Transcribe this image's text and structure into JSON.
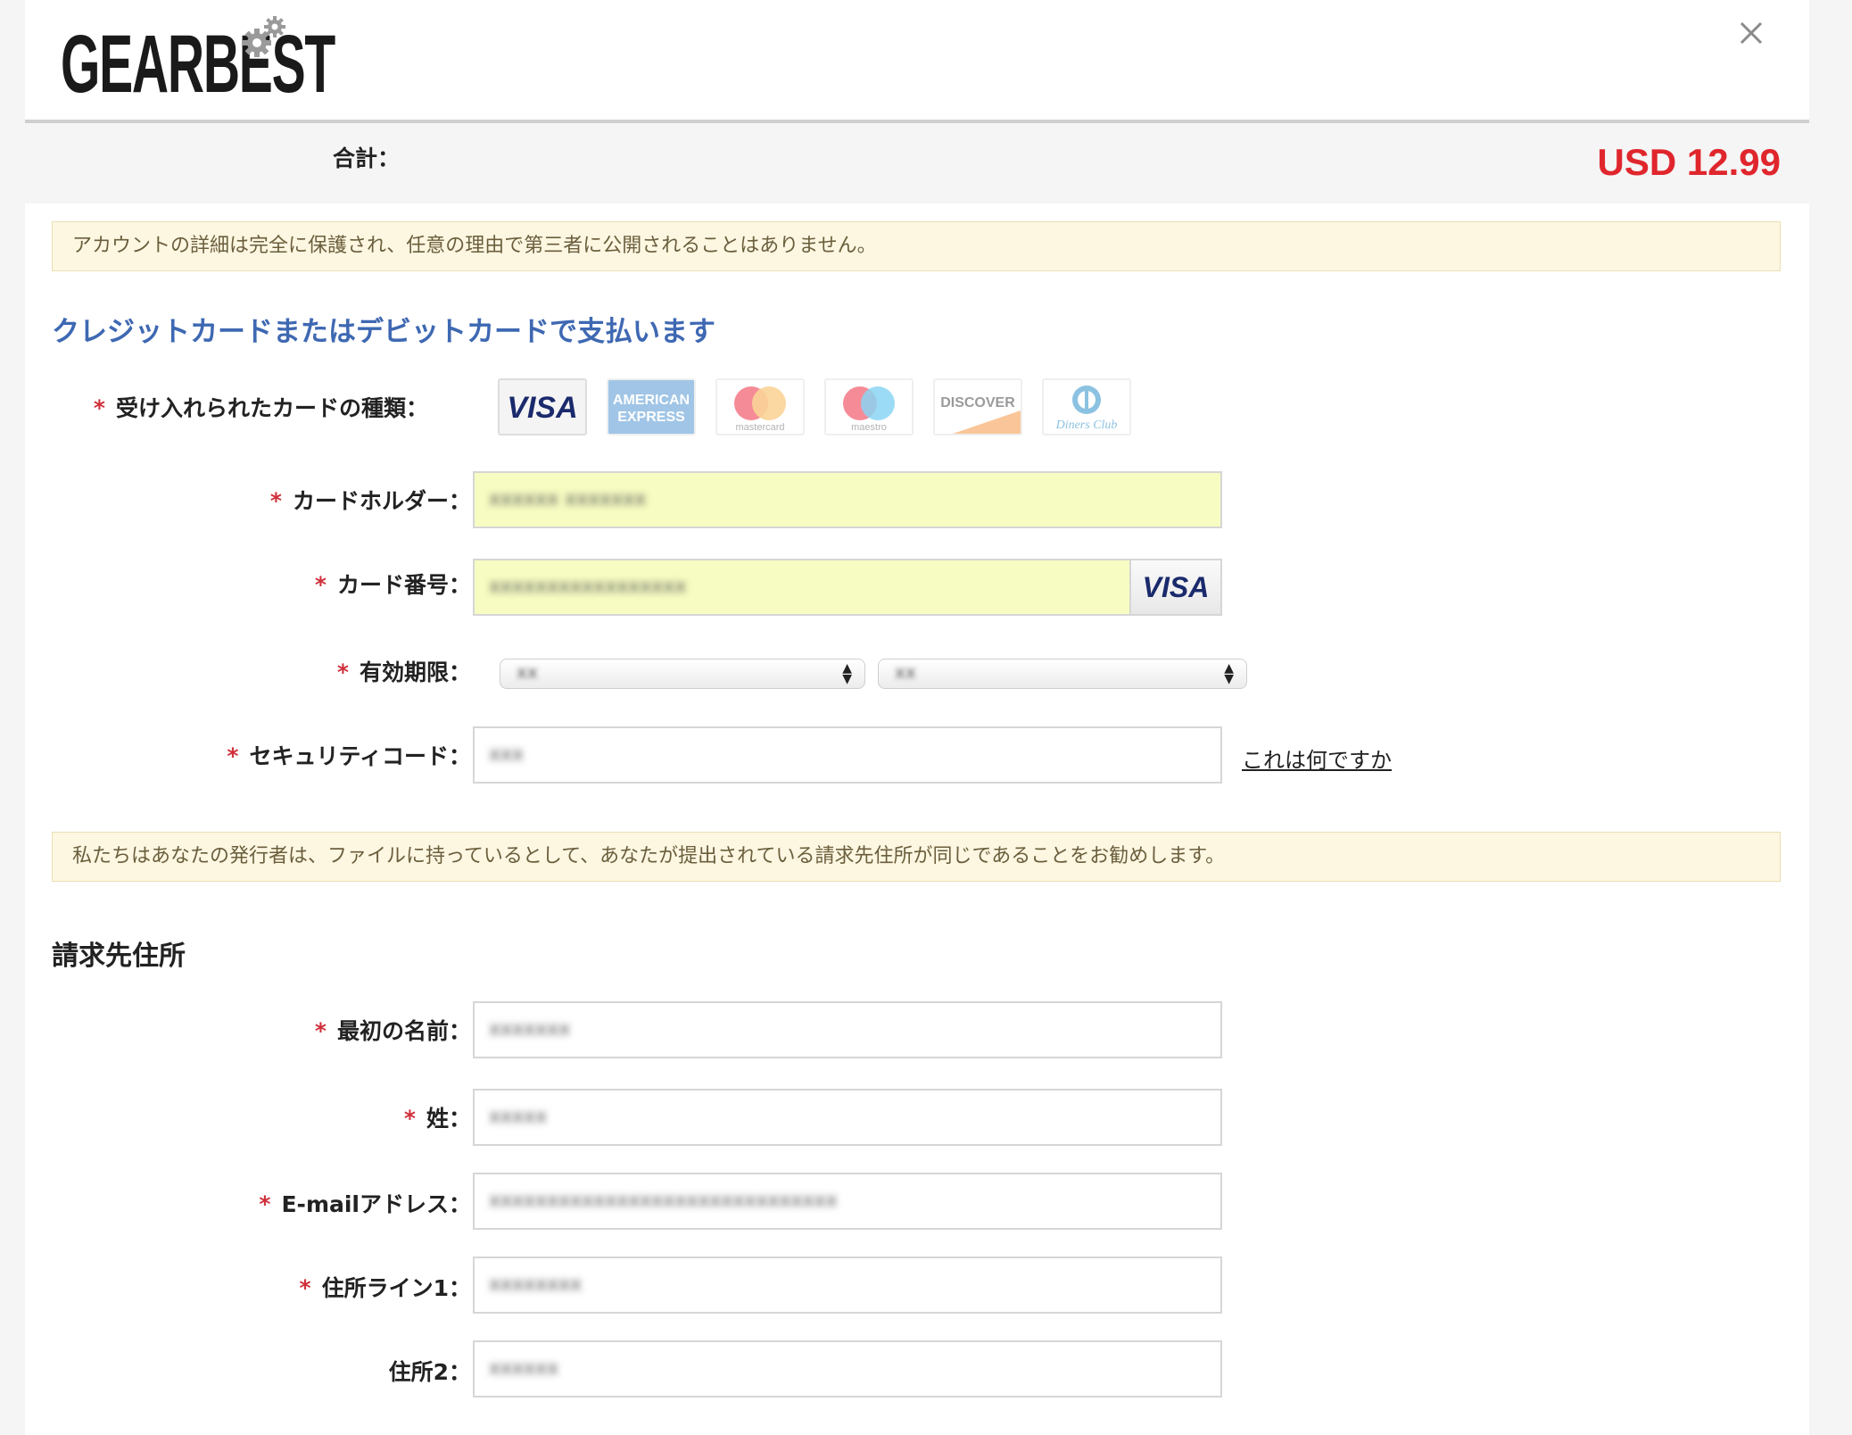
{
  "header": {
    "logo_text": "GEARBEST",
    "logo_icon": "gear-icon",
    "close_icon": "close-icon"
  },
  "total": {
    "label": "合計：",
    "amount": "USD 12.99",
    "amount_color": "#e0262d"
  },
  "notice_privacy": "アカウントの詳細は完全に保護され、任意の理由で第三者に公開されることはありません。",
  "payment": {
    "title": "クレジットカードまたはデビットカードで支払います",
    "title_color": "#3e68b2",
    "accepted_cards_label": "受け入れられたカードの種類：",
    "accepted_cards": [
      "VISA",
      "AMERICAN EXPRESS",
      "mastercard",
      "maestro",
      "DISCOVER",
      "Diners Club"
    ],
    "cardholder_label": "カードホルダー：",
    "cardholder_value": "xxxxxx xxxxxxx",
    "card_number_label": "カード番号：",
    "card_number_value": "xxxxxxxxxxxxxxxxx",
    "card_brand_badge": "VISA",
    "expiry_label": "有効期限：",
    "expiry_month_value": "xx",
    "expiry_year_value": "xx",
    "cvv_label": "セキュリティコード：",
    "cvv_value": "xxx",
    "cvv_help_link": "これは何ですか"
  },
  "notice_billing": "私たちはあなたの発行者は、ファイルに持っているとして、あなたが提出されている請求先住所が同じであることをお勧めします。",
  "billing": {
    "title": "請求先住所",
    "first_name_label": "最初の名前：",
    "first_name_value": "xxxxxxx",
    "last_name_label": "姓：",
    "last_name_value": "xxxxx",
    "email_label": "E-mailアドレス：",
    "email_value": "xxxxxxxxxxxxxxxxxxxxxxxxxxxxxx",
    "address1_label": "住所ライン1：",
    "address1_value": "xxxxxxxx",
    "address2_label": "住所2：",
    "address2_value": "xxxxxx"
  },
  "required_marker": "*"
}
